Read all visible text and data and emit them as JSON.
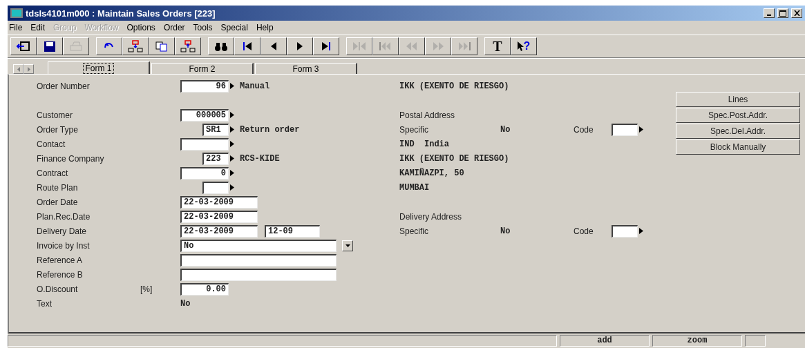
{
  "window": {
    "title": "tdsls4101m000 : Maintain Sales Orders [223]"
  },
  "menu": [
    {
      "label": "File",
      "disabled": false
    },
    {
      "label": "Edit",
      "disabled": false
    },
    {
      "label": "Group",
      "disabled": true
    },
    {
      "label": "Workflow",
      "disabled": true
    },
    {
      "label": "Options",
      "disabled": false
    },
    {
      "label": "Order",
      "disabled": false
    },
    {
      "label": "Tools",
      "disabled": false
    },
    {
      "label": "Special",
      "disabled": false
    },
    {
      "label": "Help",
      "disabled": false
    }
  ],
  "toolbar": [
    [
      {
        "kind": "exit",
        "disabled": false
      },
      {
        "kind": "save",
        "disabled": false
      },
      {
        "kind": "print",
        "disabled": true
      }
    ],
    [
      {
        "kind": "undo",
        "disabled": false
      },
      {
        "kind": "insert",
        "disabled": false
      },
      {
        "kind": "copy",
        "disabled": false
      },
      {
        "kind": "delete",
        "disabled": false
      }
    ],
    [
      {
        "kind": "find",
        "disabled": false
      },
      {
        "kind": "first",
        "disabled": false
      },
      {
        "kind": "prev",
        "disabled": false
      },
      {
        "kind": "next",
        "disabled": false
      },
      {
        "kind": "last",
        "disabled": false
      }
    ],
    [
      {
        "kind": "first-set",
        "disabled": true
      },
      {
        "kind": "first-page",
        "disabled": true
      },
      {
        "kind": "prev-page",
        "disabled": true
      },
      {
        "kind": "next-page",
        "disabled": true
      },
      {
        "kind": "last-page",
        "disabled": true
      }
    ],
    [
      {
        "kind": "text",
        "label": "T",
        "disabled": false
      },
      {
        "kind": "help",
        "label": "?",
        "disabled": false
      }
    ]
  ],
  "tabs": [
    {
      "label": "Form 1",
      "selected": true
    },
    {
      "label": "Form 2",
      "selected": false
    },
    {
      "label": "Form 3",
      "selected": false
    }
  ],
  "fields": [
    {
      "label": "Order Number",
      "fields": [
        {
          "value": "96",
          "kind": "number"
        }
      ],
      "zoom": true,
      "description": "Manual"
    },
    {
      "kind": "blank"
    },
    {
      "label": "Customer",
      "fields": [
        {
          "value": "000005",
          "kind": "number"
        }
      ],
      "zoom": true
    },
    {
      "label": "Order Type",
      "fields": [
        {
          "value": "SR1",
          "kind": "tag"
        }
      ],
      "zoom": true,
      "description": "Return order"
    },
    {
      "label": "Contact",
      "fields": [
        {
          "kind": "code"
        }
      ],
      "zoom": true
    },
    {
      "label": "Finance Company",
      "fields": [
        {
          "value": "223",
          "kind": "tag"
        }
      ],
      "zoom": true,
      "description": "RCS-KIDE"
    },
    {
      "label": "Contract",
      "fields": [
        {
          "value": "0",
          "kind": "number"
        }
      ],
      "zoom": true
    },
    {
      "label": "Route Plan",
      "fields": [
        {
          "kind": "tag"
        }
      ],
      "zoom": true
    },
    {
      "label": "Order Date",
      "fields": [
        {
          "value": "22-03-2009",
          "kind": "date"
        }
      ],
      "zoom": false
    },
    {
      "label": "Plan.Rec.Date",
      "fields": [
        {
          "value": "22-03-2009",
          "kind": "date"
        }
      ],
      "zoom": false
    },
    {
      "label": "Delivery Date",
      "fields": [
        {
          "value": "22-03-2009",
          "kind": "date"
        },
        {
          "value": "12-09",
          "kind": "time"
        }
      ],
      "zoom": false
    },
    {
      "label": "Invoice by Inst",
      "fields": [
        {
          "value": "No",
          "kind": "dropdown"
        }
      ],
      "zoom": false
    },
    {
      "label": "Reference A",
      "fields": [
        {
          "kind": "text"
        }
      ],
      "zoom": false
    },
    {
      "label": "Reference B",
      "fields": [
        {
          "kind": "text"
        }
      ],
      "zoom": false
    },
    {
      "label": "O.Discount",
      "unit": "[%]",
      "fields": [
        {
          "value": "0.00",
          "kind": "number"
        }
      ],
      "zoom": false
    },
    {
      "label": "Text",
      "fields": [
        {
          "value": "No",
          "kind": "plain"
        }
      ],
      "zoom": false
    }
  ],
  "address": [
    {
      "kind": "value",
      "text": "IKK (EXENTO DE RIESGO)"
    },
    {
      "kind": "blank"
    },
    {
      "kind": "heading",
      "text": "Postal Address"
    },
    {
      "kind": "specific",
      "label": "Specific",
      "value": "No",
      "code_label": "Code"
    },
    {
      "kind": "value",
      "text": "IND  India"
    },
    {
      "kind": "value",
      "text": "IKK (EXENTO DE RIESGO)"
    },
    {
      "kind": "value",
      "text": "KAMIÑAZPI, 50"
    },
    {
      "kind": "value",
      "text": "MUMBAI"
    },
    {
      "kind": "blank"
    },
    {
      "kind": "heading",
      "text": "Delivery Address"
    },
    {
      "kind": "specific",
      "label": "Specific",
      "value": "No",
      "code_label": "Code"
    }
  ],
  "buttons": [
    "Lines",
    "Spec.Post.Addr.",
    "Spec.Del.Addr.",
    "Block Manually"
  ],
  "status_bar": [
    "add",
    "zoom"
  ]
}
